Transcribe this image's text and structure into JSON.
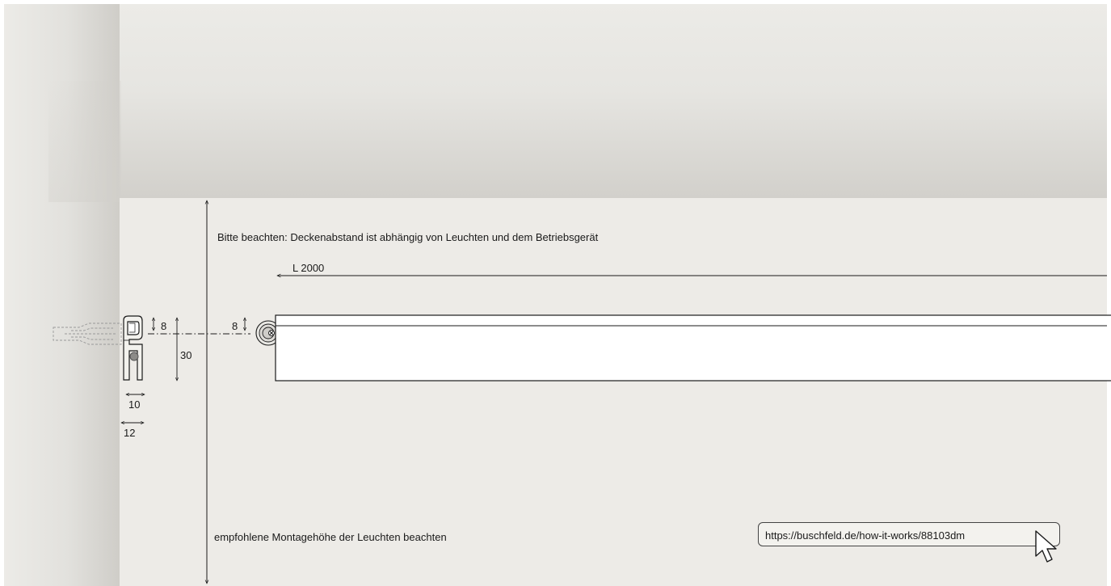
{
  "notes": {
    "ceiling_note": "Bitte beachten: Deckenabstand ist abhängig von Leuchten und dem Betriebsgerät",
    "height_note": "empfohlene Montagehöhe der Leuchten beachten"
  },
  "dimensions": {
    "length": "L 2000",
    "rail_offset": "8",
    "profile_height": "30",
    "bar_offset": "8",
    "profile_width_inner": "10",
    "profile_width_outer": "12"
  },
  "link": {
    "url": "https://buschfeld.de/how-it-works/88103dm"
  },
  "icons": {
    "cursor": "mouse-pointer-icon"
  },
  "colors": {
    "wall": "#edebe7",
    "ceiling": "#d2d0cb",
    "line": "#1a1a1a"
  }
}
